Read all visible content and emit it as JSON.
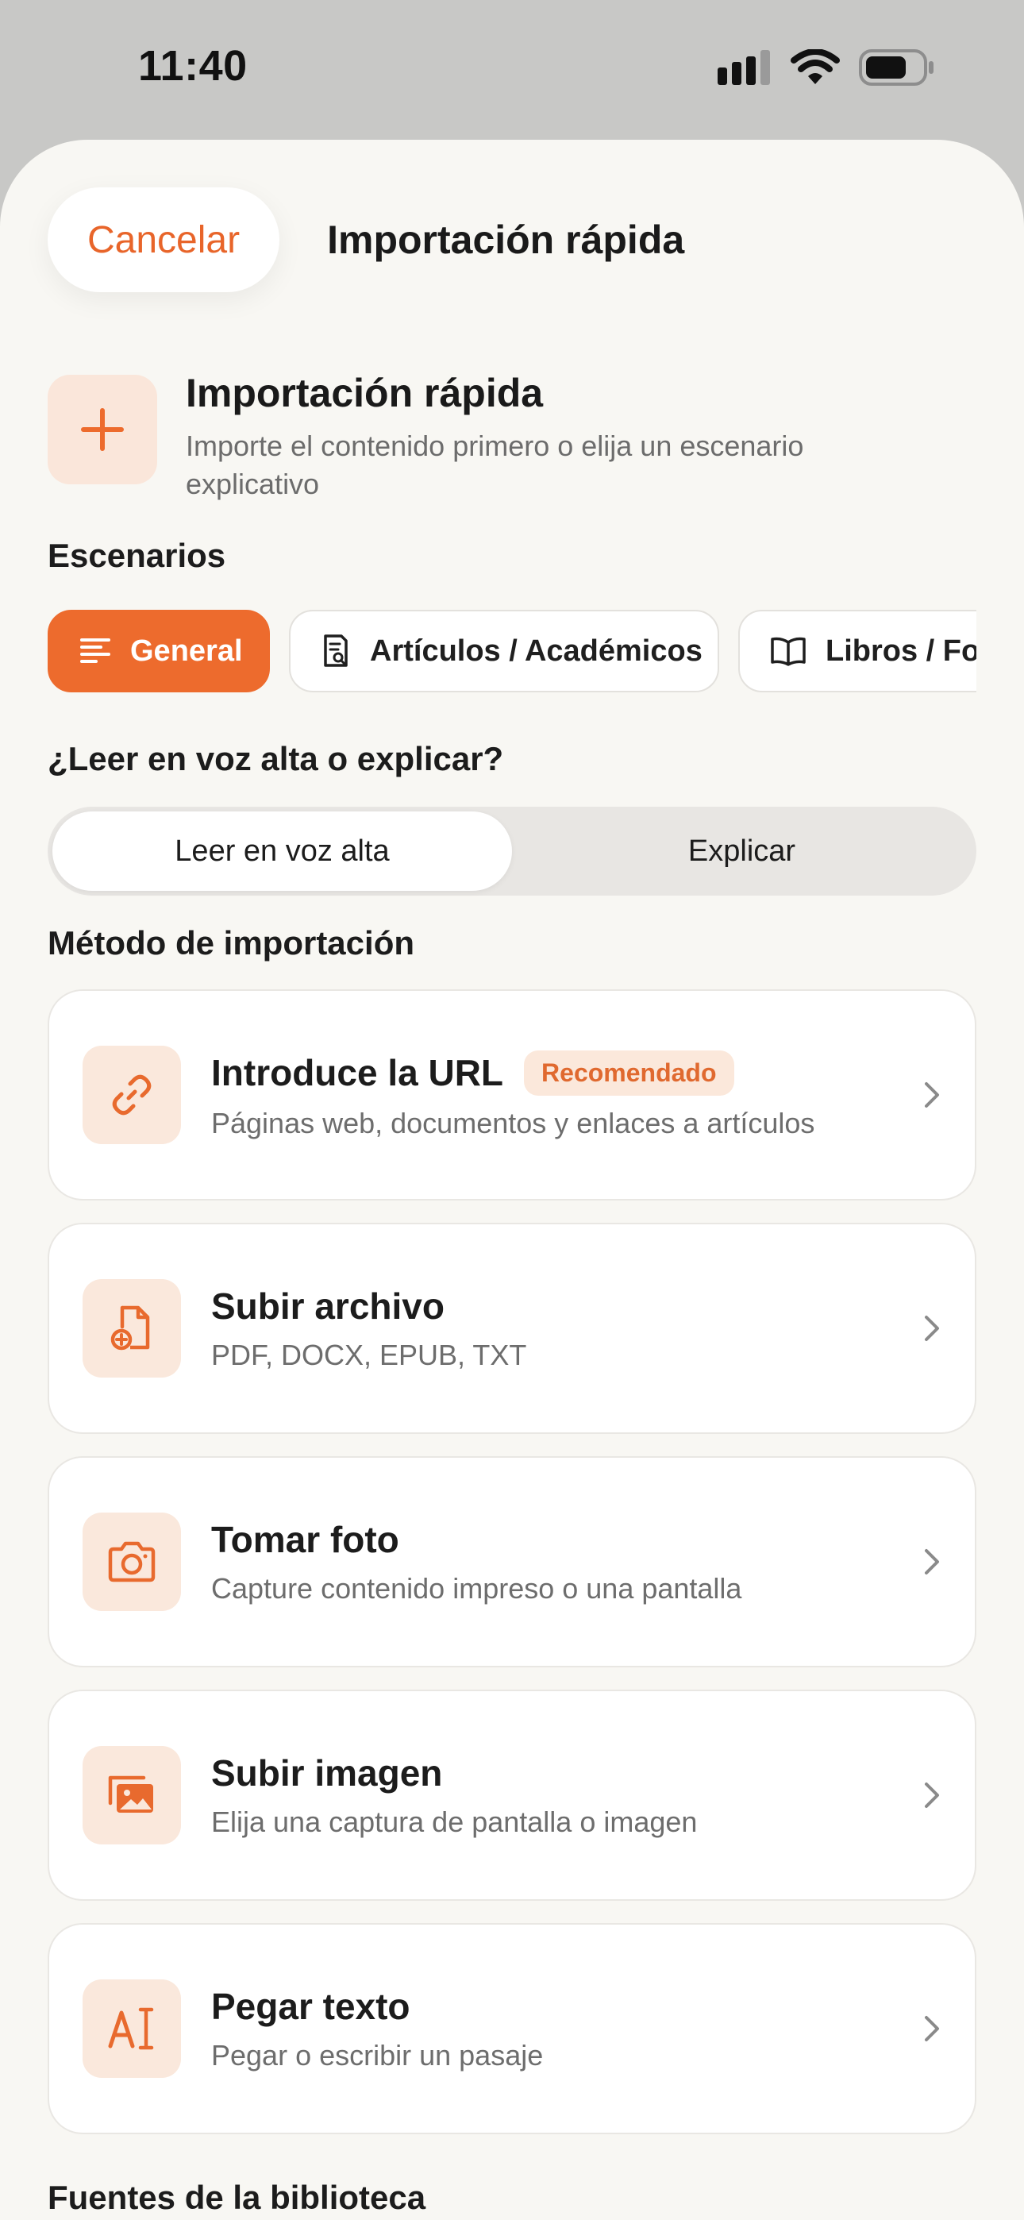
{
  "status": {
    "time": "11:40"
  },
  "nav": {
    "cancel_label": "Cancelar",
    "title": "Importación rápida"
  },
  "hero": {
    "title": "Importación rápida",
    "subtitle": "Importe el contenido primero o elija un escenario explicativo"
  },
  "scenarios": {
    "label": "Escenarios",
    "chips": [
      {
        "label": "General",
        "icon": "lines-icon",
        "active": true
      },
      {
        "label": "Artículos / Académicos",
        "icon": "document-search-icon",
        "active": false
      },
      {
        "label": "Libros / Formación",
        "icon": "book-icon",
        "active": false
      }
    ]
  },
  "mode": {
    "label": "¿Leer en voz alta o explicar?",
    "options": [
      {
        "label": "Leer en voz alta",
        "active": true
      },
      {
        "label": "Explicar",
        "active": false
      }
    ]
  },
  "import_method": {
    "label": "Método de importación",
    "items": [
      {
        "title": "Introduce la URL",
        "badge": "Recomendado",
        "subtitle": "Páginas web, documentos y enlaces a artículos",
        "icon": "link-icon"
      },
      {
        "title": "Subir archivo",
        "subtitle": "PDF, DOCX, EPUB, TXT",
        "icon": "file-add-icon"
      },
      {
        "title": "Tomar foto",
        "subtitle": "Capture contenido impreso o una pantalla",
        "icon": "camera-icon"
      },
      {
        "title": "Subir imagen",
        "subtitle": "Elija una captura de pantalla o imagen",
        "icon": "images-icon"
      },
      {
        "title": "Pegar texto",
        "subtitle": "Pegar o escribir un pasaje",
        "icon": "text-cursor-icon"
      }
    ]
  },
  "library": {
    "label": "Fuentes de la biblioteca"
  },
  "colors": {
    "accent": "#ed6b2d",
    "accent_soft": "#fae6da",
    "sheet_bg": "#f8f7f3"
  }
}
